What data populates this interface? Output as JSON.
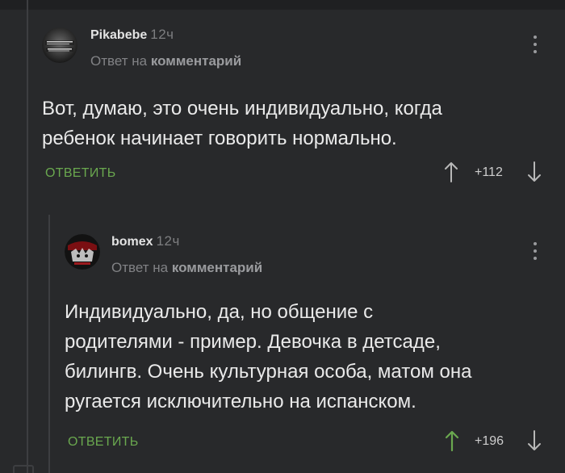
{
  "comments": [
    {
      "author": "Pikabebe",
      "time": "12ч",
      "reply_prefix": "Ответ на",
      "reply_target": "комментарий",
      "text_lines": [
        "Вот, думаю, это очень индивидуально, когда",
        "ребенок начинает говорить нормально."
      ],
      "reply_label": "ОТВЕТИТЬ",
      "rating": "+112",
      "upvoted": false
    },
    {
      "author": "bomex",
      "time": "12ч",
      "reply_prefix": "Ответ на",
      "reply_target": "комментарий",
      "text_lines": [
        "Индивидуально, да, но общение с",
        "родителями - пример. Девочка в детсаде,",
        "билингв. Очень культурная особа, матом она",
        "ругается исключительно на испанском."
      ],
      "reply_label": "ОТВЕТИТЬ",
      "rating": "+196",
      "upvoted": true
    }
  ],
  "colors": {
    "background": "#28292b",
    "accent_green": "#6aa84f",
    "muted_text": "#818285"
  },
  "icons": [
    "avatar",
    "more-vertical-icon",
    "arrow-up-icon",
    "arrow-down-icon"
  ]
}
